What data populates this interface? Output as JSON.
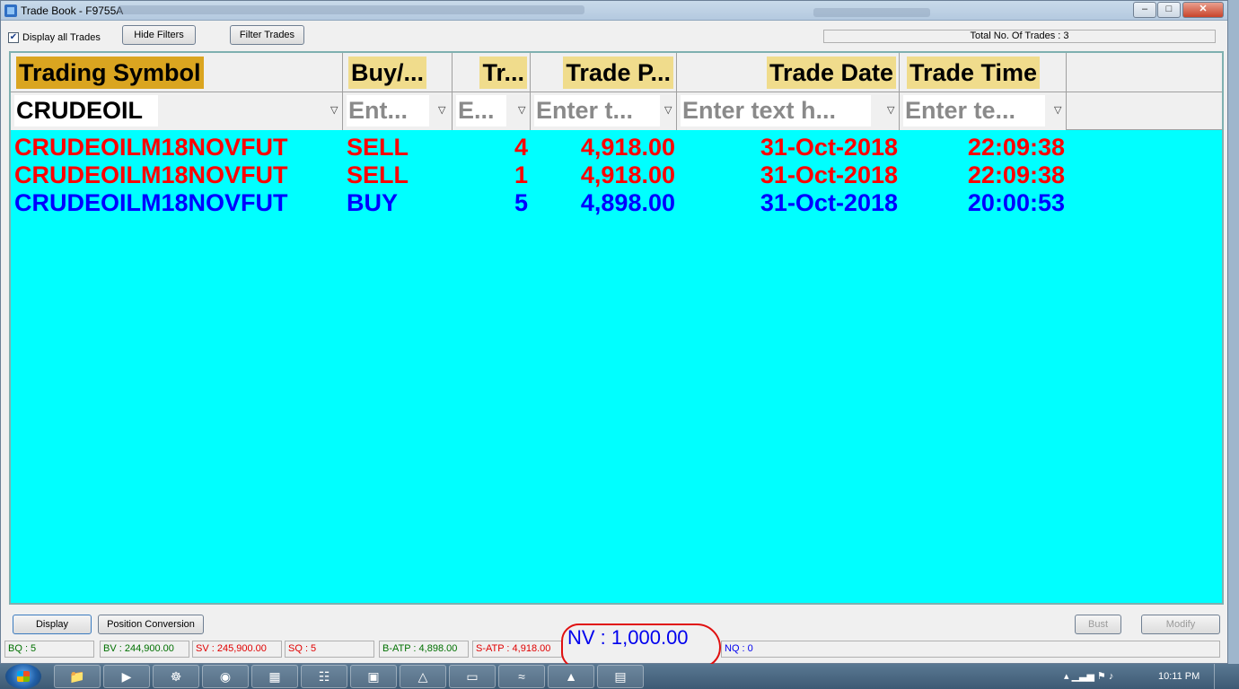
{
  "window": {
    "title": "Trade Book - F9755A",
    "controls": {
      "minimize": "–",
      "maximize": "□",
      "close": "✕"
    }
  },
  "toolbar": {
    "display_all_label": "Display all Trades",
    "display_all_checked": "✔",
    "hide_filters_label": "Hide Filters",
    "filter_trades_label": "Filter Trades",
    "total_trades": "Total No. Of Trades : 3"
  },
  "grid": {
    "background": "#00ffff",
    "columns": [
      {
        "label": "Trading Symbol",
        "filter": "CRUDEOIL",
        "filter_is_placeholder": false
      },
      {
        "label": "Buy/...",
        "filter": "Ent...",
        "filter_is_placeholder": true
      },
      {
        "label": "Tr...",
        "filter": "E...",
        "filter_is_placeholder": true
      },
      {
        "label": "Trade P...",
        "filter": "Enter t...",
        "filter_is_placeholder": true
      },
      {
        "label": "Trade Date",
        "filter": "Enter text h...",
        "filter_is_placeholder": true
      },
      {
        "label": "Trade Time",
        "filter": "Enter te...",
        "filter_is_placeholder": true
      }
    ],
    "rows": [
      {
        "symbol": "CRUDEOILM18NOVFUT",
        "side": "SELL",
        "qty": "4",
        "price": "4,918.00",
        "date": "31-Oct-2018",
        "time": "22:09:38",
        "color": "#ff0000"
      },
      {
        "symbol": "CRUDEOILM18NOVFUT",
        "side": "SELL",
        "qty": "1",
        "price": "4,918.00",
        "date": "31-Oct-2018",
        "time": "22:09:38",
        "color": "#ff0000"
      },
      {
        "symbol": "CRUDEOILM18NOVFUT",
        "side": "BUY",
        "qty": "5",
        "price": "4,898.00",
        "date": "31-Oct-2018",
        "time": "20:00:53",
        "color": "#0000ff"
      }
    ]
  },
  "bottom": {
    "display_label": "Display",
    "position_conversion_label": "Position Conversion",
    "bust_label": "Bust",
    "modify_label": "Modify"
  },
  "status": {
    "bq": "BQ : 5",
    "bv": "BV : 244,900.00",
    "sv": "SV : 245,900.00",
    "sq": "SQ : 5",
    "batp": "B-ATP : 4,898.00",
    "satp": "S-ATP : 4,918.00",
    "nv": "NV : 1,000.00",
    "nq": "NQ : 0",
    "buy_color": "#007000",
    "sell_color": "#e00000",
    "net_color": "#0000ee"
  },
  "taskbar": {
    "clock": "10:11 PM"
  }
}
